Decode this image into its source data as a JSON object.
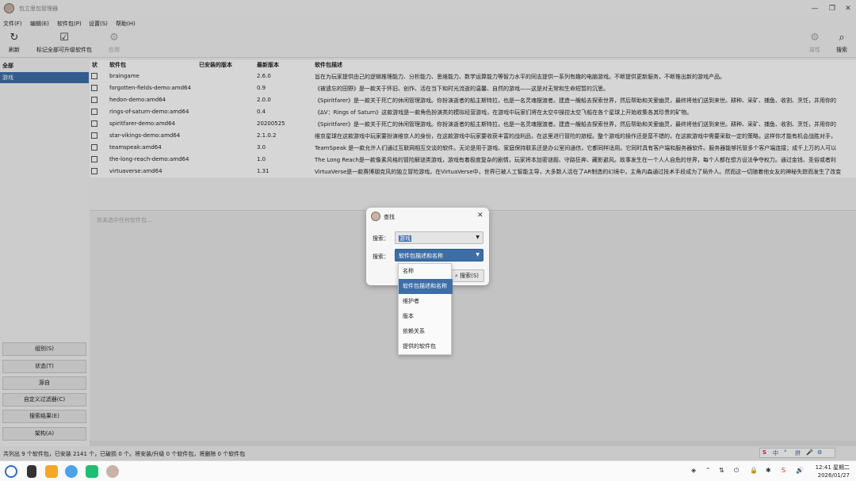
{
  "window": {
    "title": "包立思包管理器"
  },
  "menu": [
    "文件(F)",
    "编辑(E)",
    "软件包(P)",
    "设置(S)",
    "帮助(H)"
  ],
  "toolbar": {
    "refresh": "刷新",
    "mark_all": "标记全部可升级软件包",
    "apply": "应用",
    "properties": "属性",
    "search": "搜索"
  },
  "sidebar": {
    "categories": [
      "全部",
      "游戏"
    ],
    "buttons": [
      "组别(S)",
      "状态(T)",
      "源自",
      "自定义过滤器(C)",
      "搜索结果(E)",
      "架构(A)"
    ]
  },
  "table": {
    "headers": [
      "状",
      "软件包",
      "已安装的版本",
      "最新版本",
      "软件包描述"
    ],
    "rows": [
      {
        "name": "braingame",
        "installed": "",
        "latest": "2.6.0",
        "desc": "旨在为玩家提供由己的逻辑推理能力、分析能力、思维能力、数学运算能力等智力水平的同志提供一系列有趣的电脑游戏。不断提供更新服务，不断推出新的游戏产品。"
      },
      {
        "name": "forgotten-fields-demo:amd64",
        "installed": "",
        "latest": "0.9",
        "desc": "《被遗忘的田野》是一款关于怀旧、创作、活在当下和时光流逝的温馨、自然的游戏——这是对无常和生命短暂的沉思。"
      },
      {
        "name": "hedon-demo:amd64",
        "installed": "",
        "latest": "2.0.0",
        "desc": "《Spiritfarer》是一款关于死亡的休闲管理游戏。你扮演逝者的船主斯特拉，也是一名灵魂摆渡者。建造一艘船去探索世界，然后帮助和关爱幽灵，最终将他们送到来世。耕种、采矿、捕鱼、收割、烹饪，并用你的"
      },
      {
        "name": "rings-of-saturn-demo:amd64",
        "installed": "",
        "latest": "0.4",
        "desc": "《ΔV：Rings of Saturn》这款游戏是一款角色扮演类的模拟经营游戏，在游戏中玩家们将在太空中操控太空飞船在各个星球上开始收集各其珍贵的矿物。"
      },
      {
        "name": "spiritfarer-demo:amd64",
        "installed": "",
        "latest": "20200525",
        "desc": "《Spiritfarer》是一款关于死亡的休闲管理游戏。你扮演逝者的船主斯特拉，也是一名灵魂摆渡者。建造一艘船去探索世界，然后帮助和关爱幽灵，最终将他们送到来世。耕种、采矿、捕鱼、收割、烹饪，并用你的"
      },
      {
        "name": "star-vikings-demo:amd64",
        "installed": "",
        "latest": "2.1.0.2",
        "desc": "维京星球在这款游戏中玩家要扮演维京人的身份，在这款游戏中玩家要收获丰富的战利品，在这里进行冒险的旅程。整个游戏的操作还是蛮不错的，在这款游戏中需要采取一定的策略，这样你才能有机会战胜对手，"
      },
      {
        "name": "teamspeak:amd64",
        "installed": "",
        "latest": "3.0",
        "desc": "TeamSpeak 是一款允许人们通过互联网相互交谈的软件。无论是用于游戏、家庭保持联系还是办公室间通信，它都同样适用。它同时具有客户端和服务器软件。服务器能够托管多个客户端连接；成千上万的人可以"
      },
      {
        "name": "the-long-reach-demo:amd64",
        "installed": "",
        "latest": "1.0",
        "desc": "The Long Reach是一款像素风格的冒险解谜类游戏，游戏有着极度复杂的剧情，玩家将本加密谜题、守路狂奔、藏影避风。故事发生在一个人人自危的世界，每个人都在想方设法争夺权力。通过金钱、圣俗或者利"
      },
      {
        "name": "virtuaverse:amd64",
        "installed": "",
        "latest": "1.31",
        "desc": "VirtuaVerse是一款赛博朋克风的独立冒险游戏。在VirtuaVerse中，世界已被人工智能主导，大多数人活在了AR制造的幻境中，主角内森通过技术手段成为了局外人。然而这一切随着他女友的神秘失踪而发生了改变"
      }
    ]
  },
  "details_placeholder": "尚未选中任何软件包...",
  "status": "共列出 9 个软件包，已安装 2141 个，已破损 0 个。将安装/升级 0 个软件包，将删除 0 个软件包",
  "dialog": {
    "title": "查找",
    "search_label_1": "搜索：",
    "search_value": "游戏",
    "search_label_2": "搜索：",
    "scope_value": "软件包描述和名称",
    "search_button": "搜索(S)",
    "options": [
      "名称",
      "软件包描述和名称",
      "维护者",
      "版本",
      "依赖关系",
      "提供的软件包"
    ],
    "selected_option": "软件包描述和名称"
  },
  "ime": {
    "items": [
      "中",
      "°",
      "拼",
      "🎤",
      "⚙"
    ]
  },
  "clock": {
    "time": "12:41 星期二",
    "date": "2026/01/27"
  },
  "colors": {
    "selection": "#3d6ea8",
    "background": "#f2f2f2"
  }
}
